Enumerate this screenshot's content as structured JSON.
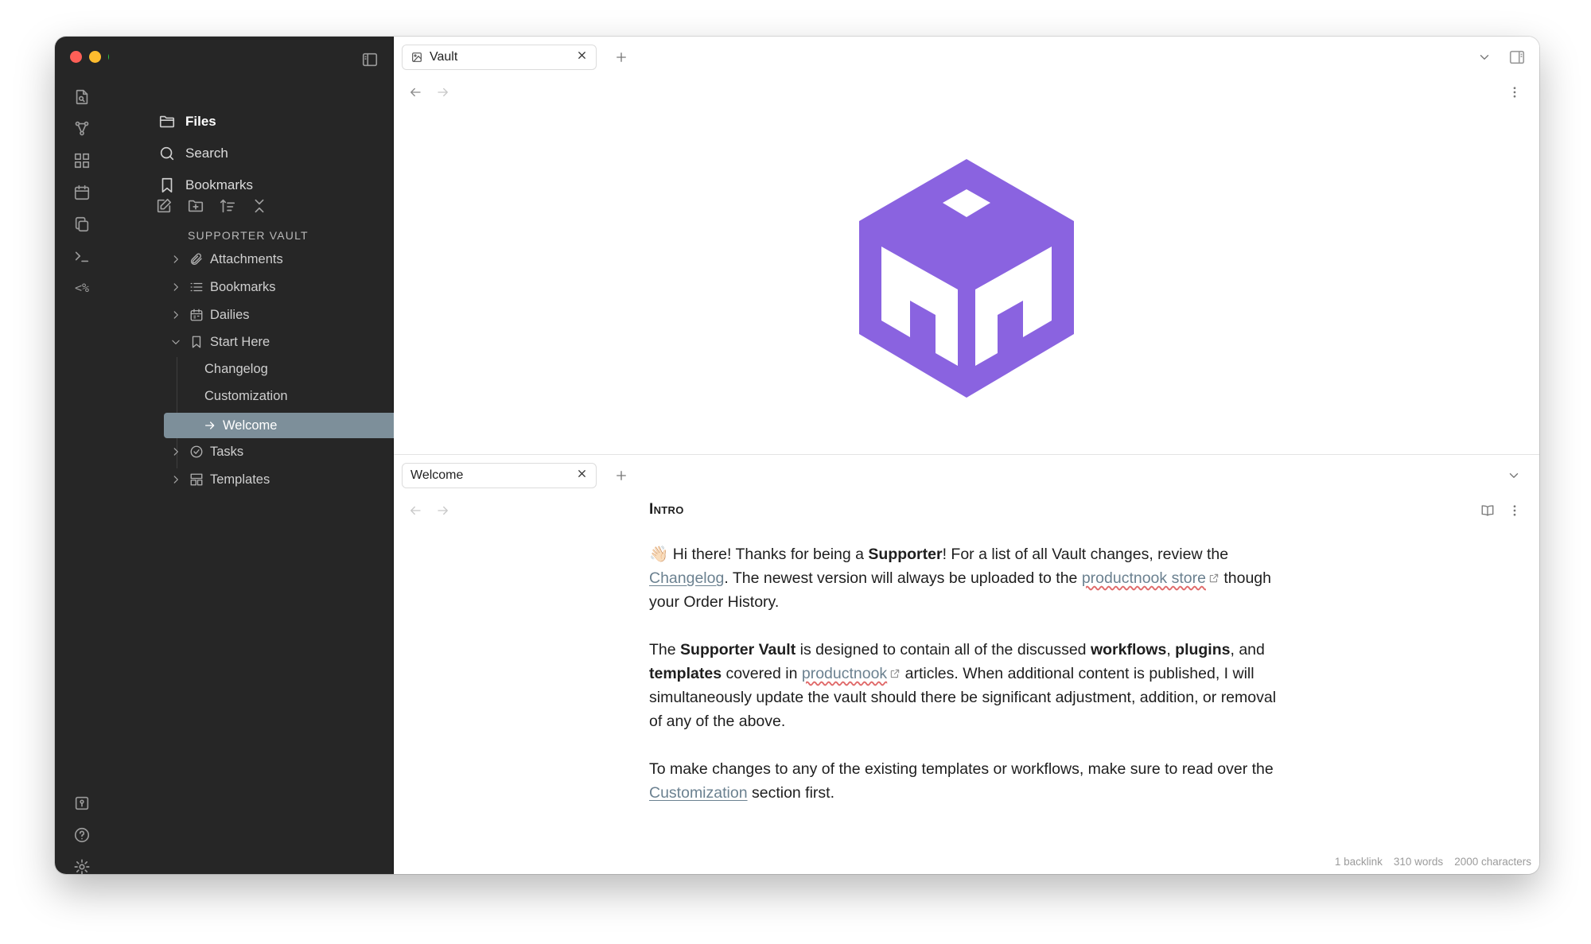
{
  "colors": {
    "sidebar_bg": "#262626",
    "selected_row": "#7d8f9a",
    "logo_purple": "#8a63e0",
    "link": "#6b8190",
    "traffic_red": "#fe5f57",
    "traffic_yellow": "#febc2e",
    "traffic_green": "#28c840"
  },
  "ribbon": {
    "icons": [
      "file-search-icon",
      "graph-icon",
      "canvas-icon",
      "calendar-icon",
      "copy-icon",
      "terminal-icon",
      "templater-icon"
    ],
    "templater_label": "<%",
    "bottom_icons": [
      "vault-switch-icon",
      "help-icon",
      "settings-icon"
    ]
  },
  "sidebar": {
    "nav": [
      {
        "label": "Files",
        "icon": "folder-icon"
      },
      {
        "label": "Search",
        "icon": "search-icon"
      },
      {
        "label": "Bookmarks",
        "icon": "bookmark-icon"
      }
    ],
    "vault_name": "SUPPORTER VAULT",
    "tree": [
      {
        "label": "Attachments",
        "icon": "paperclip-icon"
      },
      {
        "label": "Bookmarks",
        "icon": "list-icon"
      },
      {
        "label": "Dailies",
        "icon": "calendar-icon"
      },
      {
        "label": "Start Here",
        "icon": "bookmark-icon"
      },
      {
        "label": "Tasks",
        "icon": "check-circle-icon"
      },
      {
        "label": "Templates",
        "icon": "template-icon"
      }
    ],
    "start_here_children": [
      "Changelog",
      "Customization",
      "Welcome"
    ]
  },
  "top_pane": {
    "tab_title": "Vault"
  },
  "bottom_pane": {
    "tab_title": "Welcome",
    "heading": "Intro",
    "p1": {
      "wave": "👋🏻",
      "a": " Hi there! Thanks for being a ",
      "b": "Supporter",
      "c": "! For a list of all Vault changes, review the ",
      "link1": "Changelog",
      "d": ". The newest version will always be uploaded to the ",
      "link2": "productnook store",
      "e": " though your Order History."
    },
    "p2": {
      "a": "The ",
      "b": "Supporter Vault",
      "c": " is designed to contain all of the discussed ",
      "d": "workflows",
      "e": ", ",
      "f": "plugins",
      "g": ", and ",
      "h": "templates",
      "i": " covered in ",
      "link": "productnook",
      "j": " articles. When additional content is published, I will simultaneously update the vault should there be significant adjustment, addition, or removal of any of the above."
    },
    "p3": {
      "a": "To make changes to any of the existing templates or workflows, make sure to read over the ",
      "link": "Customization",
      "b": " section first."
    },
    "status": {
      "backlinks": "1 backlink",
      "words": "310 words",
      "chars": "2000 characters"
    }
  }
}
